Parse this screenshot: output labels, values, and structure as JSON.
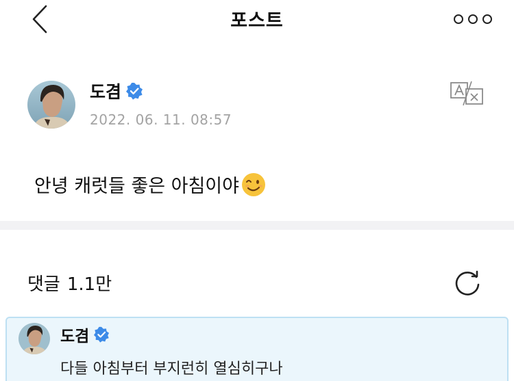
{
  "header": {
    "title": "포스트",
    "back_icon": "chevron-left-icon",
    "more_icon": "more-options-icon"
  },
  "post": {
    "author": "도겸",
    "verified_icon": "verified-badge-icon",
    "timestamp": "2022. 06. 11. 08:57",
    "translate_icon": "translate-icon",
    "text": "안녕 캐럿들 좋은 아침이야",
    "emoji_icon": "winking-face-emoji"
  },
  "comments": {
    "label": "댓글",
    "count": "1.1만",
    "refresh_icon": "refresh-icon",
    "highlighted": {
      "author": "도겸",
      "text": "다들 아침부터 부지런히 열심히구나"
    }
  },
  "colors": {
    "verified_blue": "#3d8be8",
    "timestamp_gray": "#a3a3a3",
    "highlight_bg": "#ebf6fc",
    "highlight_border": "#bde0f3",
    "separator": "#f2f2f4"
  }
}
